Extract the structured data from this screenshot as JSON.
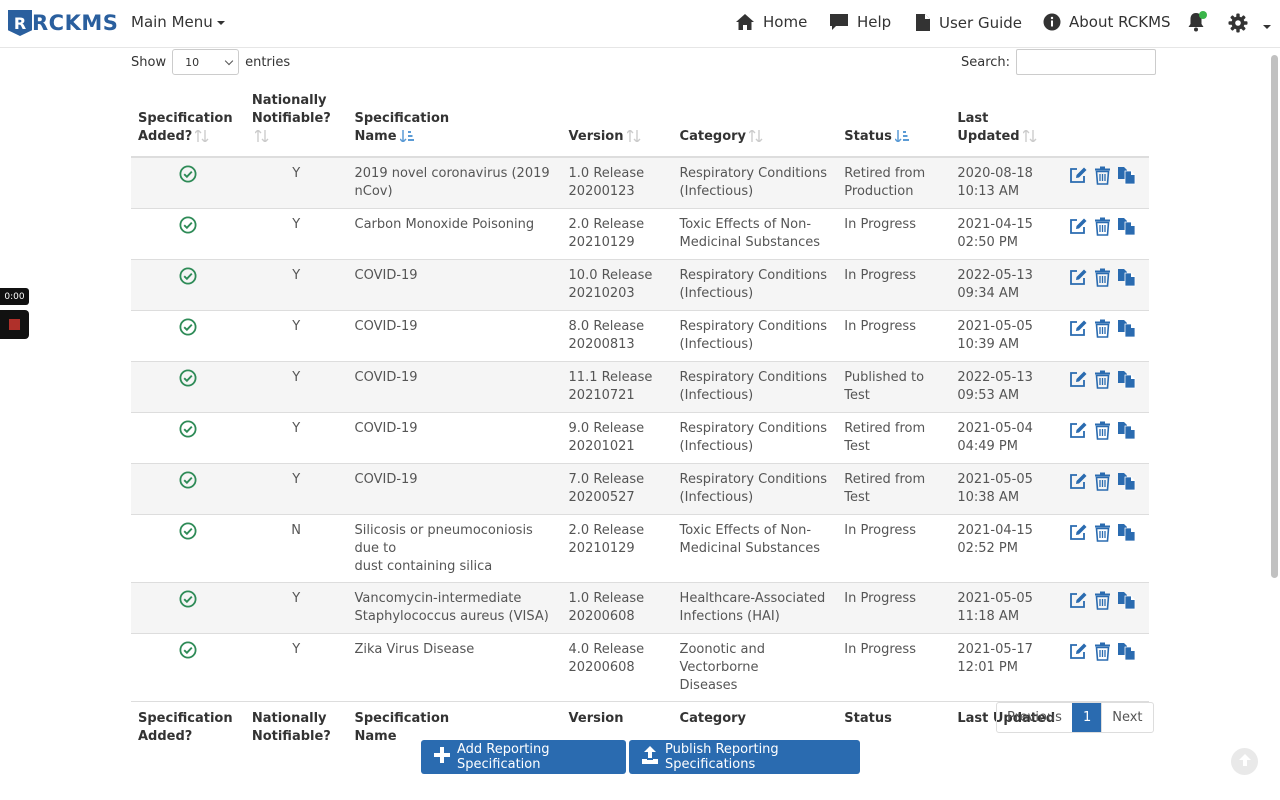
{
  "brand": {
    "name": "RCKMS",
    "logo_mark": "R"
  },
  "nav": {
    "main_menu": "Main Menu",
    "home": "Home",
    "help": "Help",
    "user_guide": "User Guide",
    "about": "About RCKMS"
  },
  "recorder": {
    "time": "0:00"
  },
  "controls": {
    "show_label": "Show",
    "page_size": "10",
    "entries_label": "entries",
    "search_label": "Search:",
    "search_value": ""
  },
  "table": {
    "headers": {
      "added_line1": "Specification",
      "added_line2": "Added?",
      "notif_line1": "Nationally",
      "notif_line2": "Notifiable?",
      "name_line1": "Specification",
      "name_line2": "Name",
      "version": "Version",
      "category": "Category",
      "status": "Status",
      "updated_line1": "Last",
      "updated_line2": "Updated"
    },
    "footers": {
      "added_line1": "Specification",
      "added_line2": "Added?",
      "notif_line1": "Nationally",
      "notif_line2": "Notifiable?",
      "name_line1": "Specification",
      "name_line2": "Name",
      "version": "Version",
      "category": "Category",
      "status": "Status",
      "updated": "Last Updated"
    },
    "rows": [
      {
        "notif": "Y",
        "name_l1": "2019 novel coronavirus (2019",
        "name_l2": "nCov)",
        "ver_l1": "1.0 Release",
        "ver_l2": "20200123",
        "cat_l1": "Respiratory Conditions",
        "cat_l2": "(Infectious)",
        "status_l1": "Retired from",
        "status_l2": "Production",
        "upd_l1": "2020-08-18",
        "upd_l2": "10:13 AM"
      },
      {
        "notif": "Y",
        "name_l1": "Carbon Monoxide Poisoning",
        "name_l2": "",
        "ver_l1": "2.0 Release",
        "ver_l2": "20210129",
        "cat_l1": "Toxic Effects of Non-",
        "cat_l2": "Medicinal Substances",
        "status_l1": "In Progress",
        "status_l2": "",
        "upd_l1": "2021-04-15",
        "upd_l2": "02:50 PM"
      },
      {
        "notif": "Y",
        "name_l1": "COVID-19",
        "name_l2": "",
        "ver_l1": "10.0 Release",
        "ver_l2": "20210203",
        "cat_l1": "Respiratory Conditions",
        "cat_l2": "(Infectious)",
        "status_l1": "In Progress",
        "status_l2": "",
        "upd_l1": "2022-05-13",
        "upd_l2": "09:34 AM"
      },
      {
        "notif": "Y",
        "name_l1": "COVID-19",
        "name_l2": "",
        "ver_l1": "8.0 Release",
        "ver_l2": "20200813",
        "cat_l1": "Respiratory Conditions",
        "cat_l2": "(Infectious)",
        "status_l1": "In Progress",
        "status_l2": "",
        "upd_l1": "2021-05-05",
        "upd_l2": "10:39 AM"
      },
      {
        "notif": "Y",
        "name_l1": "COVID-19",
        "name_l2": "",
        "ver_l1": "11.1 Release",
        "ver_l2": "20210721",
        "cat_l1": "Respiratory Conditions",
        "cat_l2": "(Infectious)",
        "status_l1": "Published to",
        "status_l2": "Test",
        "upd_l1": "2022-05-13",
        "upd_l2": "09:53 AM"
      },
      {
        "notif": "Y",
        "name_l1": "COVID-19",
        "name_l2": "",
        "ver_l1": "9.0 Release",
        "ver_l2": "20201021",
        "cat_l1": "Respiratory Conditions",
        "cat_l2": "(Infectious)",
        "status_l1": "Retired from",
        "status_l2": "Test",
        "upd_l1": "2021-05-04",
        "upd_l2": "04:49 PM"
      },
      {
        "notif": "Y",
        "name_l1": "COVID-19",
        "name_l2": "",
        "ver_l1": "7.0 Release",
        "ver_l2": "20200527",
        "cat_l1": "Respiratory Conditions",
        "cat_l2": "(Infectious)",
        "status_l1": "Retired from",
        "status_l2": "Test",
        "upd_l1": "2021-05-05",
        "upd_l2": "10:38 AM"
      },
      {
        "notif": "N",
        "name_l1": "Silicosis or pneumoconiosis due to",
        "name_l2": "dust containing silica",
        "ver_l1": "2.0 Release",
        "ver_l2": "20210129",
        "cat_l1": "Toxic Effects of Non-",
        "cat_l2": "Medicinal Substances",
        "status_l1": "In Progress",
        "status_l2": "",
        "upd_l1": "2021-04-15",
        "upd_l2": "02:52 PM"
      },
      {
        "notif": "Y",
        "name_l1": "Vancomycin-intermediate",
        "name_l2": "Staphylococcus aureus (VISA)",
        "ver_l1": "1.0 Release",
        "ver_l2": "20200608",
        "cat_l1": "Healthcare-Associated",
        "cat_l2": "Infections (HAI)",
        "status_l1": "In Progress",
        "status_l2": "",
        "upd_l1": "2021-05-05",
        "upd_l2": "11:18 AM"
      },
      {
        "notif": "Y",
        "name_l1": "Zika Virus Disease",
        "name_l2": "",
        "ver_l1": "4.0 Release",
        "ver_l2": "20200608",
        "cat_l1": "Zoonotic and Vectorborne",
        "cat_l2": "Diseases",
        "status_l1": "In Progress",
        "status_l2": "",
        "upd_l1": "2021-05-17",
        "upd_l2": "12:01 PM"
      }
    ]
  },
  "pagination": {
    "previous": "Previous",
    "current": "1",
    "next": "Next"
  },
  "buttons": {
    "add": "Add Reporting Specification",
    "publish": "Publish Reporting Specifications"
  },
  "colors": {
    "primary": "#2a6bb0",
    "success": "#2e8b57",
    "brand": "#2a5f9e",
    "notification_dot": "#3ab54a"
  },
  "icons": {
    "row_actions": [
      "edit-icon",
      "delete-icon",
      "copy-icon"
    ],
    "row_status": "check-circle-icon",
    "nav": [
      "home-icon",
      "help-icon",
      "user-guide-icon",
      "about-icon",
      "bell-icon",
      "gear-icon"
    ]
  }
}
